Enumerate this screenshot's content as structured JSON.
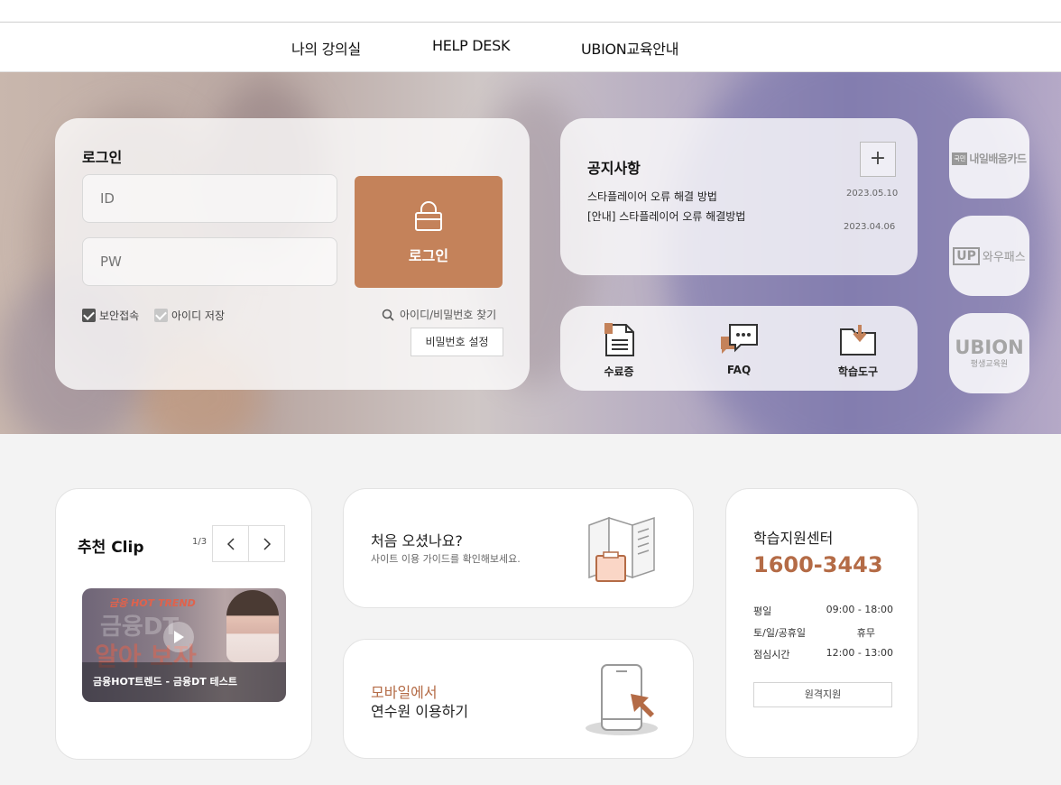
{
  "nav": {
    "items": [
      "나의 강의실",
      "HELP DESK",
      "UBION교육안내"
    ]
  },
  "login": {
    "title": "로그인",
    "id_placeholder": "ID",
    "pw_placeholder": "PW",
    "button_label": "로그인",
    "secure_label": "보안접속",
    "secure_checked": true,
    "save_id_label": "아이디 저장",
    "save_id_checked": false,
    "find_label": "아이디/비밀번호 찾기",
    "pw_setting_label": "비밀번호 설정"
  },
  "notice": {
    "title": "공지사항",
    "more_icon": "plus-icon",
    "items": [
      {
        "title": "스타플레이어 오류 해결 방법",
        "date": "2023.05.10"
      },
      {
        "title": "[안내] 스타플레이어 오류 해결방법",
        "date": "2023.04.06"
      }
    ]
  },
  "quick_links": [
    {
      "label": "수료증",
      "icon": "certificate-icon"
    },
    {
      "label": "FAQ",
      "icon": "chat-bubble-icon"
    },
    {
      "label": "학습도구",
      "icon": "folder-download-icon"
    }
  ],
  "side_logos": {
    "naeil": {
      "badge": "국민",
      "text": "내일배움카드"
    },
    "wowpass": {
      "mark": "UP",
      "text": "와우패스"
    },
    "ubion": {
      "title": "UBION",
      "subtitle": "평생교육원"
    }
  },
  "clip": {
    "title": "추천 Clip",
    "pager": "1/3",
    "video": {
      "overlay_tag": "금융 HOT TREND",
      "overlay_line1": "금융DT",
      "overlay_line2": "알아 보자",
      "caption": "금융HOT트렌드 - 금융DT 테스트"
    }
  },
  "first_visit": {
    "title": "처음 오셨나요?",
    "subtitle": "사이트 이용 가이드를 확인해보세요."
  },
  "mobile": {
    "line1": "모바일에서",
    "line2": "연수원 이용하기"
  },
  "support": {
    "title": "학습지원센터",
    "phone": "1600-3443",
    "hours": [
      {
        "label": "평일",
        "value": "09:00 - 18:00"
      },
      {
        "label": "토/일/공휴일",
        "value": "휴무"
      },
      {
        "label": "점심시간",
        "value": "12:00 - 13:00"
      }
    ],
    "remote_label": "원격지원"
  },
  "colors": {
    "accent": "#c4825a",
    "phone": "#b46b46",
    "mobile_accent": "#b46b46"
  }
}
